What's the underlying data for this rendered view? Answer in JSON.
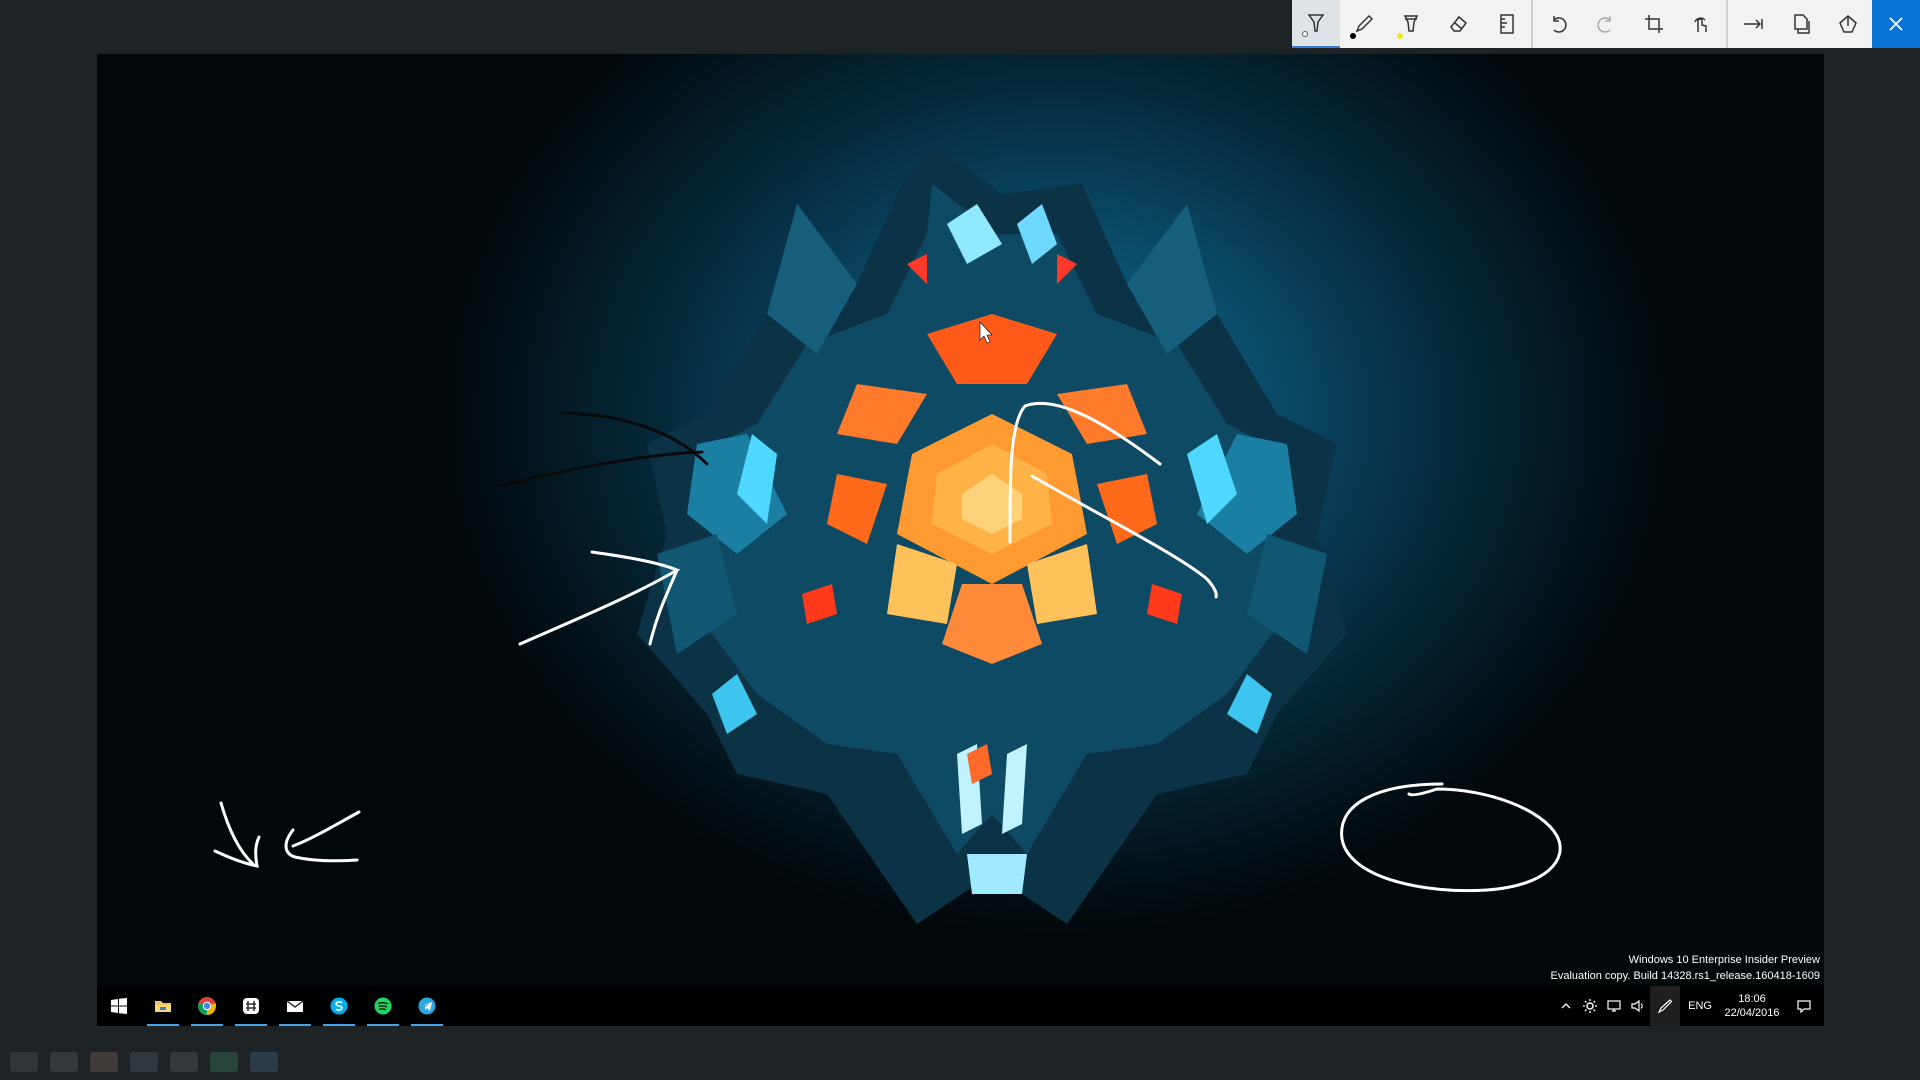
{
  "toolbar": {
    "tools": [
      {
        "name": "ballpoint-pen",
        "icon": "ballpoint-pen-icon",
        "selected": true,
        "ink_color": "#ffffff"
      },
      {
        "name": "pencil",
        "icon": "pencil-icon",
        "selected": false,
        "ink_color": "#000000"
      },
      {
        "name": "highlighter",
        "icon": "highlighter-icon",
        "selected": false,
        "ink_color": "#f2e71c"
      },
      {
        "name": "eraser",
        "icon": "eraser-icon",
        "selected": false
      },
      {
        "name": "ruler",
        "icon": "ruler-icon",
        "selected": false
      },
      {
        "name": "undo",
        "icon": "undo-icon"
      },
      {
        "name": "redo",
        "icon": "redo-icon",
        "disabled": true
      },
      {
        "name": "crop",
        "icon": "crop-icon"
      },
      {
        "name": "touch-writing",
        "icon": "touch-writing-icon"
      },
      {
        "name": "save",
        "icon": "save-arrow-icon"
      },
      {
        "name": "copy",
        "icon": "copy-icon"
      },
      {
        "name": "share",
        "icon": "share-icon"
      },
      {
        "name": "close",
        "icon": "close-icon"
      }
    ],
    "accent": "#0a74d6"
  },
  "desktop": {
    "wallpaper_colors": [
      "#0f6c93",
      "#062b3d",
      "#ff6a1a",
      "#ffb347",
      "#4fd8ff"
    ]
  },
  "taskbar": {
    "apps": [
      {
        "name": "start",
        "icon": "windows-logo-icon",
        "active": false
      },
      {
        "name": "file-explorer",
        "icon": "folder-icon",
        "active": true
      },
      {
        "name": "chrome",
        "icon": "chrome-icon",
        "active": true
      },
      {
        "name": "slack",
        "icon": "slack-icon",
        "active": true
      },
      {
        "name": "mail",
        "icon": "mail-icon",
        "active": true
      },
      {
        "name": "skype",
        "icon": "skype-icon",
        "active": true
      },
      {
        "name": "spotify",
        "icon": "spotify-icon",
        "active": true
      },
      {
        "name": "telegram",
        "icon": "telegram-icon",
        "active": true
      }
    ],
    "tray": {
      "language": "ENG",
      "time": "18:06",
      "date": "22/04/2016"
    }
  },
  "watermark": {
    "line1": "Windows 10 Enterprise Insider Preview",
    "line2": "Evaluation copy. Build 14328.rs1_release.160418-1609"
  }
}
